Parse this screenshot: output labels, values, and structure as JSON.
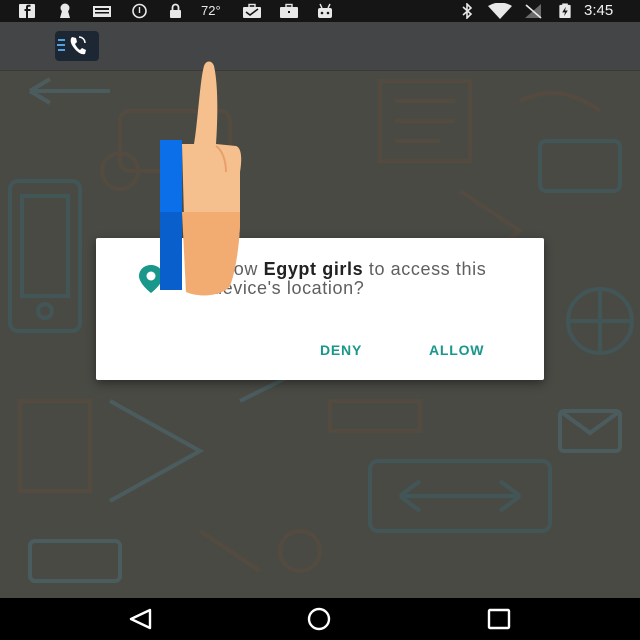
{
  "status_bar": {
    "temperature": "72°",
    "time": "3:45",
    "icons": [
      "facebook-icon",
      "keyhole-icon",
      "news-icon",
      "data-saver-icon",
      "lock-icon",
      "briefcase-icon",
      "bag-icon",
      "android-icon",
      "bluetooth-icon",
      "wifi-icon",
      "no-signal-icon",
      "battery-charging-icon"
    ]
  },
  "app_bar": {
    "logo_icon": "phone-call-logo-icon"
  },
  "dialog": {
    "message_prefix": "Allow ",
    "app_name": "Egypt girls",
    "message_suffix": " to access this device's location?",
    "icon": "location-pin-icon",
    "deny_label": "DENY",
    "allow_label": "ALLOW",
    "accent_color": "#18978a"
  },
  "overlay": {
    "icon": "thumbs-up-hand-icon",
    "bar_color": "#0a6fe8",
    "skin_color": "#f6b57e"
  },
  "nav_bar": {
    "icons": [
      "back-triangle-icon",
      "home-circle-icon",
      "recents-square-icon"
    ]
  }
}
